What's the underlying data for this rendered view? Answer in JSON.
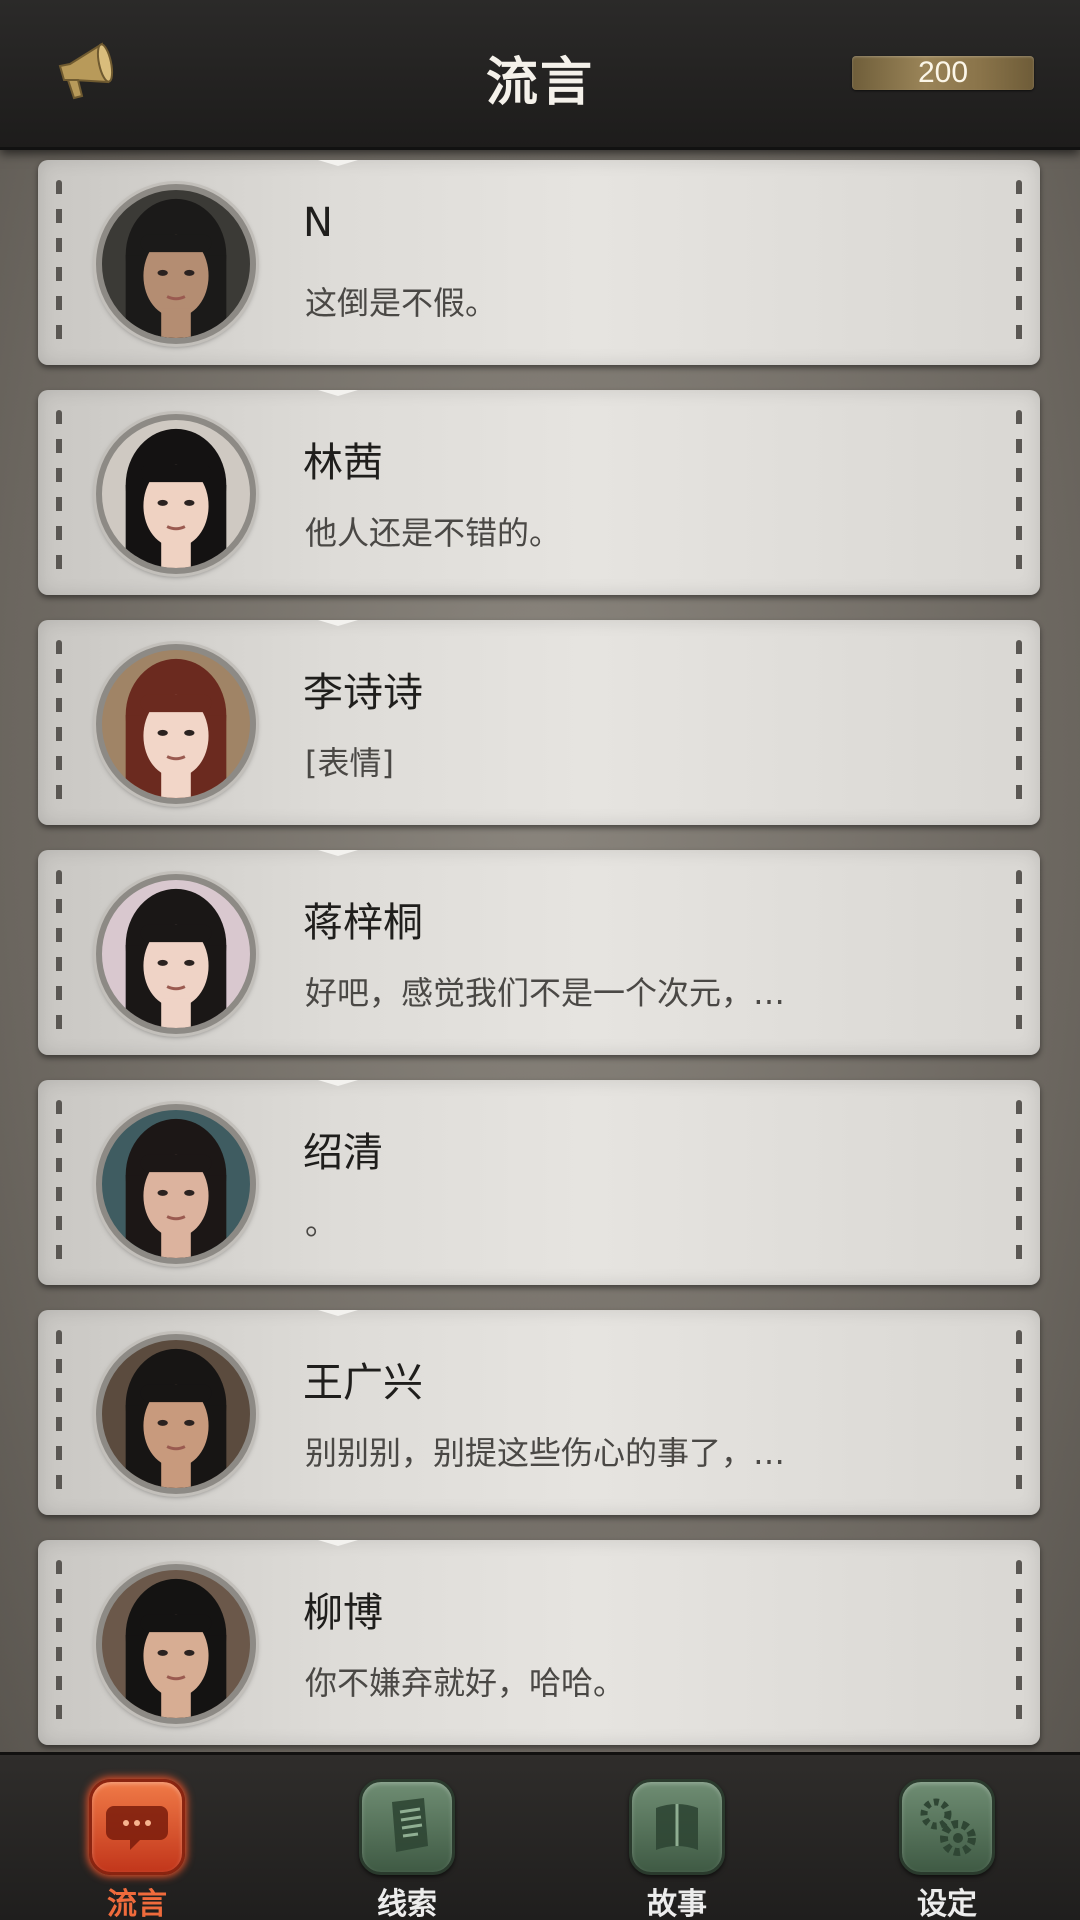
{
  "header": {
    "title": "流言",
    "coins": "200",
    "left_icon": "megaphone-icon"
  },
  "messages": [
    {
      "name": "N",
      "preview": "这倒是不假。",
      "avatar": {
        "skin": "#b48d72",
        "hair": "#1b1a19",
        "bg": "#3b3a36"
      }
    },
    {
      "name": "林茜",
      "preview": "他人还是不错的。",
      "avatar": {
        "skin": "#efd2c2",
        "hair": "#141212",
        "bg": "#cfc9c2"
      }
    },
    {
      "name": "李诗诗",
      "preview": "[表情]",
      "avatar": {
        "skin": "#f2d6c8",
        "hair": "#6b2a1f",
        "bg": "#a08466"
      }
    },
    {
      "name": "蒋梓桐",
      "preview": "好吧，感觉我们不是一个次元，…",
      "avatar": {
        "skin": "#efd3c6",
        "hair": "#1a1716",
        "bg": "#d9c8cf"
      }
    },
    {
      "name": "绍清",
      "preview": "。",
      "avatar": {
        "skin": "#dcb39e",
        "hair": "#1c1716",
        "bg": "#3f5c61"
      }
    },
    {
      "name": "王广兴",
      "preview": "别别别，别提这些伤心的事了，…",
      "avatar": {
        "skin": "#c89a7d",
        "hair": "#171514",
        "bg": "#5b4b3e"
      }
    },
    {
      "name": "柳博",
      "preview": "你不嫌弃就好，哈哈。",
      "avatar": {
        "skin": "#d7ad93",
        "hair": "#141312",
        "bg": "#6b584a"
      }
    }
  ],
  "nav": [
    {
      "label": "流言",
      "icon": "chat-bubble-icon",
      "active": true
    },
    {
      "label": "线索",
      "icon": "clue-papers-icon",
      "active": false
    },
    {
      "label": "故事",
      "icon": "story-book-icon",
      "active": false
    },
    {
      "label": "设定",
      "icon": "settings-gear-icon",
      "active": false
    }
  ]
}
